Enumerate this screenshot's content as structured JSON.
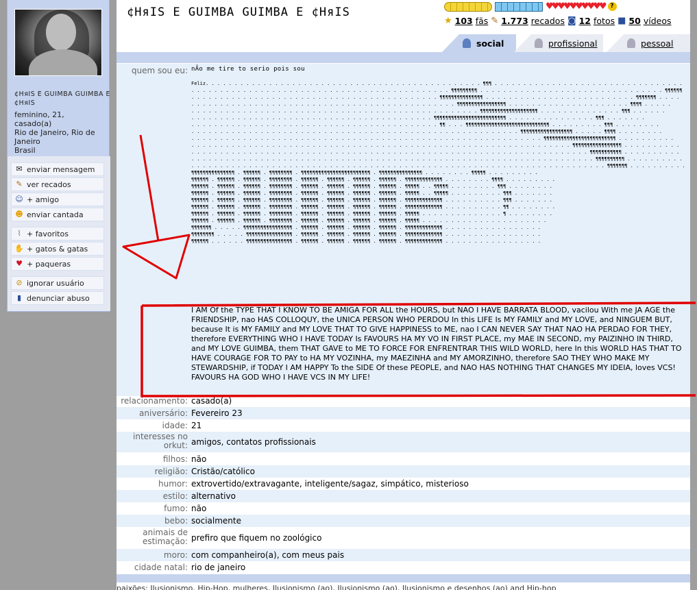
{
  "profile": {
    "name_short": "¢HяIS E GUIMBA GUIMBA E ¢HяIS",
    "gender_age": "feminino, 21,",
    "status": "casado(a)",
    "city": "Rio de Janeiro, Rio de Janeiro",
    "country": "Brasil"
  },
  "menu": {
    "group1": [
      {
        "label": "enviar mensagem",
        "icon": "envelope-icon"
      },
      {
        "label": "ver recados",
        "icon": "scrap-icon"
      },
      {
        "label": "+ amigo",
        "icon": "add-friend-icon"
      },
      {
        "label": "enviar cantada",
        "icon": "smiley-icon"
      }
    ],
    "group2": [
      {
        "label": "+ favoritos",
        "icon": "clip-icon"
      },
      {
        "label": "+ gatos & gatas",
        "icon": "hand-icon"
      },
      {
        "label": "+ paqueras",
        "icon": "heart-icon"
      }
    ],
    "group3": [
      {
        "label": "ignorar usuário",
        "icon": "ignore-icon"
      },
      {
        "label": "denunciar abuso",
        "icon": "report-icon"
      }
    ]
  },
  "header": {
    "title": "¢HяIS E GUIMBA GUIMBA E ¢HяIS",
    "fans_count": "103",
    "fans_label": "fãs",
    "scraps_count": "1.773",
    "scraps_label": "recados",
    "photos_count": "12",
    "photos_label": "fotos",
    "videos_count": "50",
    "videos_label": "vídeos"
  },
  "tabs": [
    {
      "label": "social",
      "active": true
    },
    {
      "label": "profissional",
      "active": false
    },
    {
      "label": "pessoal",
      "active": false
    }
  ],
  "about": {
    "label": "quem sou eu:",
    "ascii_head": "nÃo me tire to serio pois sou",
    "ascii_feliz": "Feliz",
    "text": "I AM Of the TYPE THAT I KNOW TO BE AMIGA FOR ALL the HOURS, but NAO I HAVE BARRATA BLOOD, vacilou With me JA AGE the FRIENDSHIP, nao HAS COLLOQUY, the UNICA PERSON WHO PERDOU In this LIFE Is MY FAMILY and MY LOVE, and NINGUEM BUT, because It is MY FAMILY and MY LOVE THAT TO GIVE HAPPINESS to ME, nao I CAN NEVER SAY THAT NAO HA PERDAO FOR THEY, therefore EVERYTHING WHO I HAVE TODAY Is FAVOURS HA MY VO IN FIRST PLACE, my MAE IN SECOND, my PAIZINHO IN THIRD, and MY LOVE GUIMBA, them THAT GAVE to ME TO FORCE FOR ENFRENTRAR THIS WILD WORLD, here In this WORLD HAS THAT TO HAVE COURAGE FOR TO PAY to HA MY VOZINHA, my MAEZINHA and MY AMORZINHO, therefore SAO THEY WHO MAKE MY STEWARDSHIP, if TODAY I AM HAPPY To the SIDE Of these PEOPLE, and NAO HAS NOTHING THAT CHANGES MY IDEIA, loves VCS! FAVOURS HA GOD WHO I HAVE VCS IN MY LIFE!"
  },
  "fields": [
    {
      "label": "relacionamento:",
      "value": "casado(a)"
    },
    {
      "label": "aniversário:",
      "value": "Fevereiro 23"
    },
    {
      "label": "idade:",
      "value": "21"
    },
    {
      "label": "interesses no orkut:",
      "value": "amigos, contatos profissionais"
    },
    {
      "label": "filhos:",
      "value": "não"
    },
    {
      "label": "religião:",
      "value": "Cristão/católico"
    },
    {
      "label": "humor:",
      "value": "extrovertido/extravagante, inteligente/sagaz, simpático, misterioso"
    },
    {
      "label": "estilo:",
      "value": "alternativo"
    },
    {
      "label": "fumo:",
      "value": "não"
    },
    {
      "label": "bebo:",
      "value": "socialmente"
    },
    {
      "label": "animais de estimação:",
      "value": "prefiro que fiquem no zoológico"
    },
    {
      "label": "moro:",
      "value": "com companheiro(a), com meus pais"
    },
    {
      "label": "cidade natal:",
      "value": "rio de janeiro"
    }
  ],
  "bottom_cut": "paixões:  Ilusionismo, Hip-Hop, mulheres, Ilusionismo (ao), Ilusionismo (ao), Ilusionismo e desenhos (ao) and Hip-hop",
  "colors": {
    "annotation": "#e00000",
    "accent": "#c5d3ee",
    "about_bg": "#e6f0fa"
  }
}
